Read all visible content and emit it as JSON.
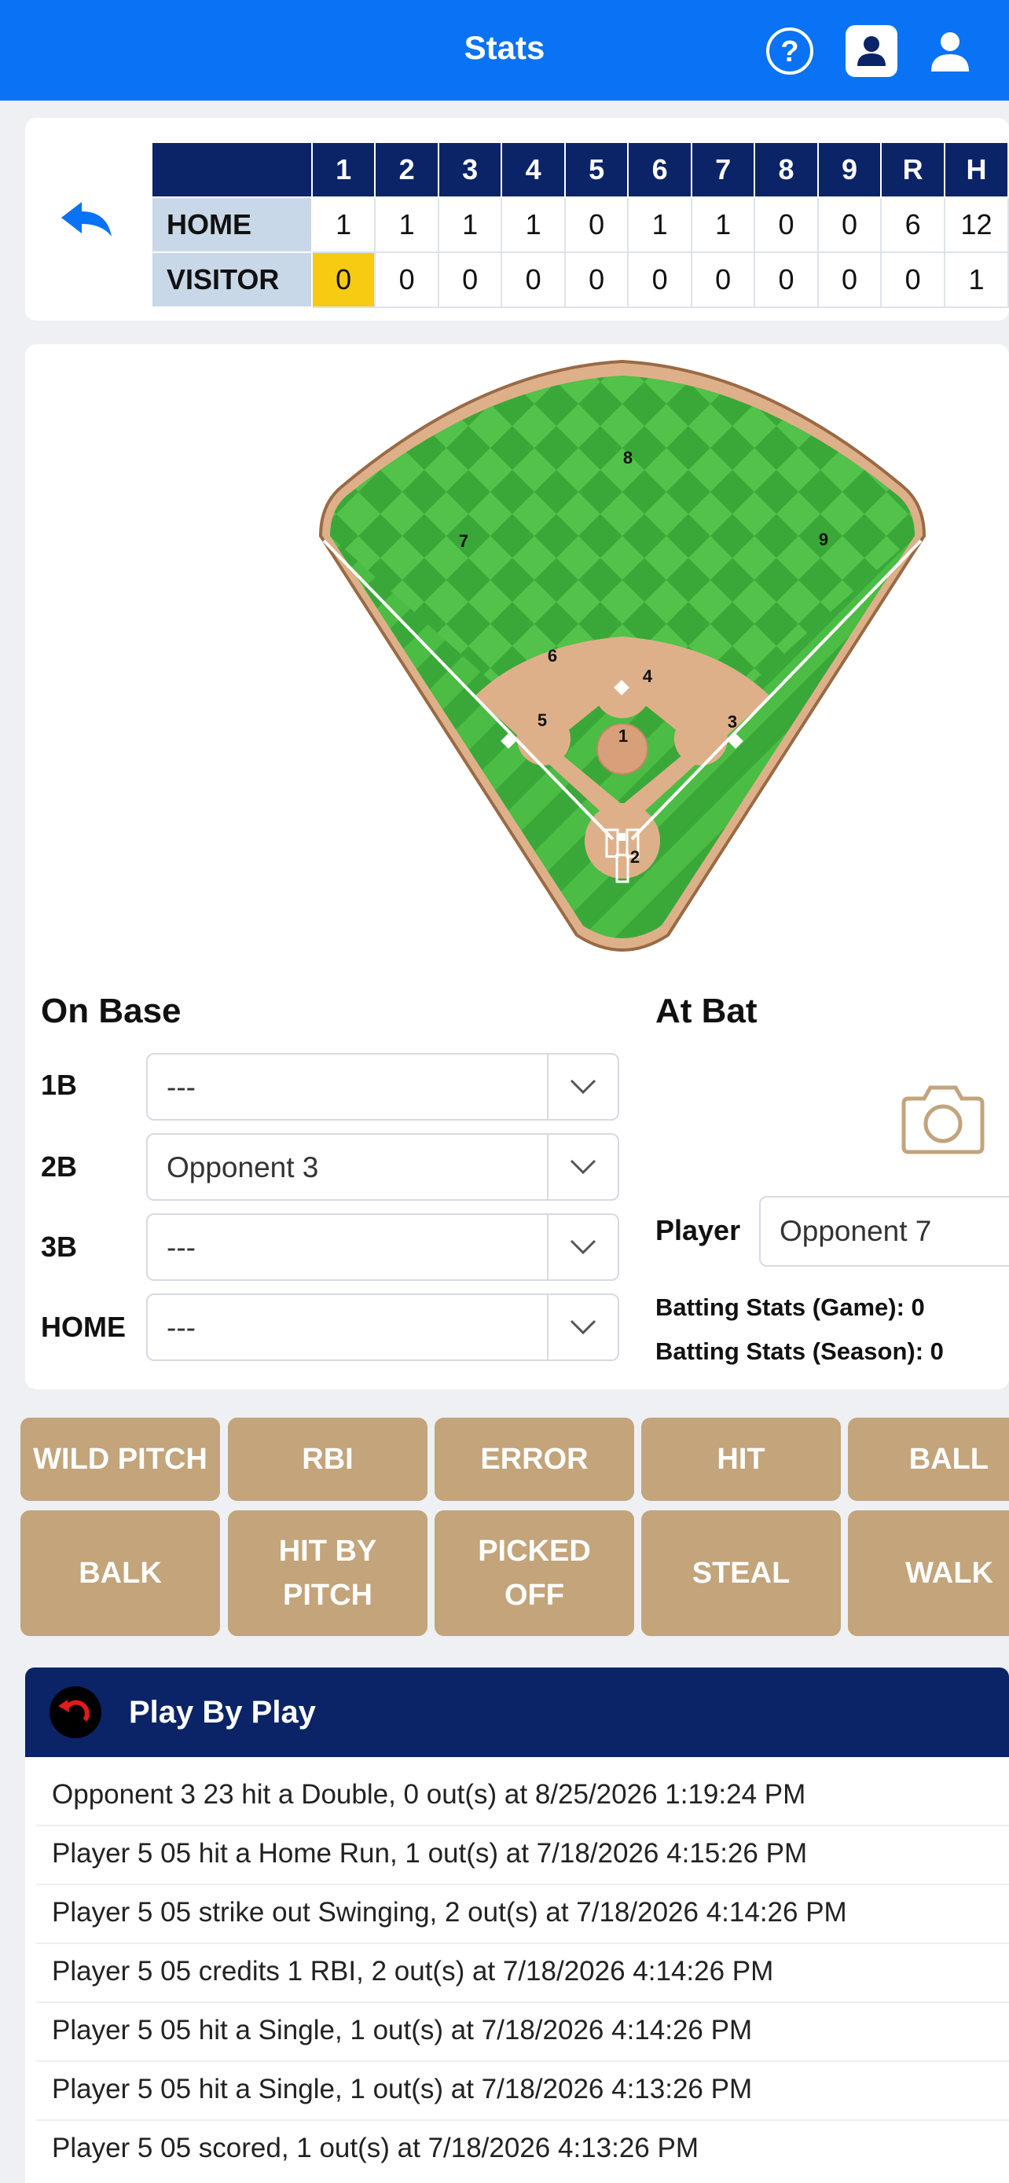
{
  "header": {
    "title": "Stats",
    "icons": [
      "help-icon",
      "id-badge-icon",
      "user-icon"
    ]
  },
  "scoreboard": {
    "columns": [
      "1",
      "2",
      "3",
      "4",
      "5",
      "6",
      "7",
      "8",
      "9",
      "R",
      "H"
    ],
    "rows": [
      {
        "team": "HOME",
        "values": [
          "1",
          "1",
          "1",
          "1",
          "0",
          "1",
          "1",
          "0",
          "0",
          "6",
          "12"
        ]
      },
      {
        "team": "VISITOR",
        "values": [
          "0",
          "0",
          "0",
          "0",
          "0",
          "0",
          "0",
          "0",
          "0",
          "0",
          "1"
        ]
      }
    ],
    "current_inning_highlight": "#f6cb12"
  },
  "field": {
    "positions": [
      "1",
      "2",
      "3",
      "4",
      "5",
      "6",
      "7",
      "8",
      "9"
    ]
  },
  "on_base": {
    "title": "On Base",
    "bases": [
      {
        "label": "1B",
        "value": "---"
      },
      {
        "label": "2B",
        "value": "Opponent 3"
      },
      {
        "label": "3B",
        "value": "---"
      },
      {
        "label": "HOME",
        "value": "---"
      }
    ]
  },
  "at_bat": {
    "title": "At Bat",
    "player_label": "Player",
    "player_value": "Opponent 7",
    "game_stats": "Batting Stats (Game): 0",
    "season_stats": "Batting Stats (Season): 0"
  },
  "actions": {
    "row1": [
      "WILD PITCH",
      "RBI",
      "ERROR",
      "HIT",
      "BALL"
    ],
    "row2": [
      {
        "l1": "BALK",
        "l2": ""
      },
      {
        "l1": "HIT BY",
        "l2": "PITCH"
      },
      {
        "l1": "PICKED",
        "l2": "OFF"
      },
      {
        "l1": "STEAL",
        "l2": ""
      },
      {
        "l1": "WALK",
        "l2": ""
      }
    ]
  },
  "play_by_play": {
    "title": "Play By Play",
    "items": [
      "Opponent 3 23 hit a Double, 0 out(s) at 8/25/2026 1:19:24 PM",
      "Player 5 05 hit a Home Run, 1 out(s) at 7/18/2026 4:15:26 PM",
      "Player 5 05 strike out Swinging, 2 out(s) at 7/18/2026 4:14:26 PM",
      "Player 5 05 credits 1 RBI, 2 out(s) at 7/18/2026 4:14:26 PM",
      "Player 5 05 hit a Single, 1 out(s) at 7/18/2026 4:14:26 PM",
      "Player 5 05 hit a Single, 1 out(s) at 7/18/2026 4:13:26 PM",
      "Player 5 05 scored, 1 out(s) at 7/18/2026 4:13:26 PM"
    ]
  },
  "colors": {
    "accent": "#0a72f5",
    "navy": "#0b2467",
    "action_button": "#c3a47b",
    "grass": "#3fae3a",
    "dirt": "#deb08a"
  }
}
